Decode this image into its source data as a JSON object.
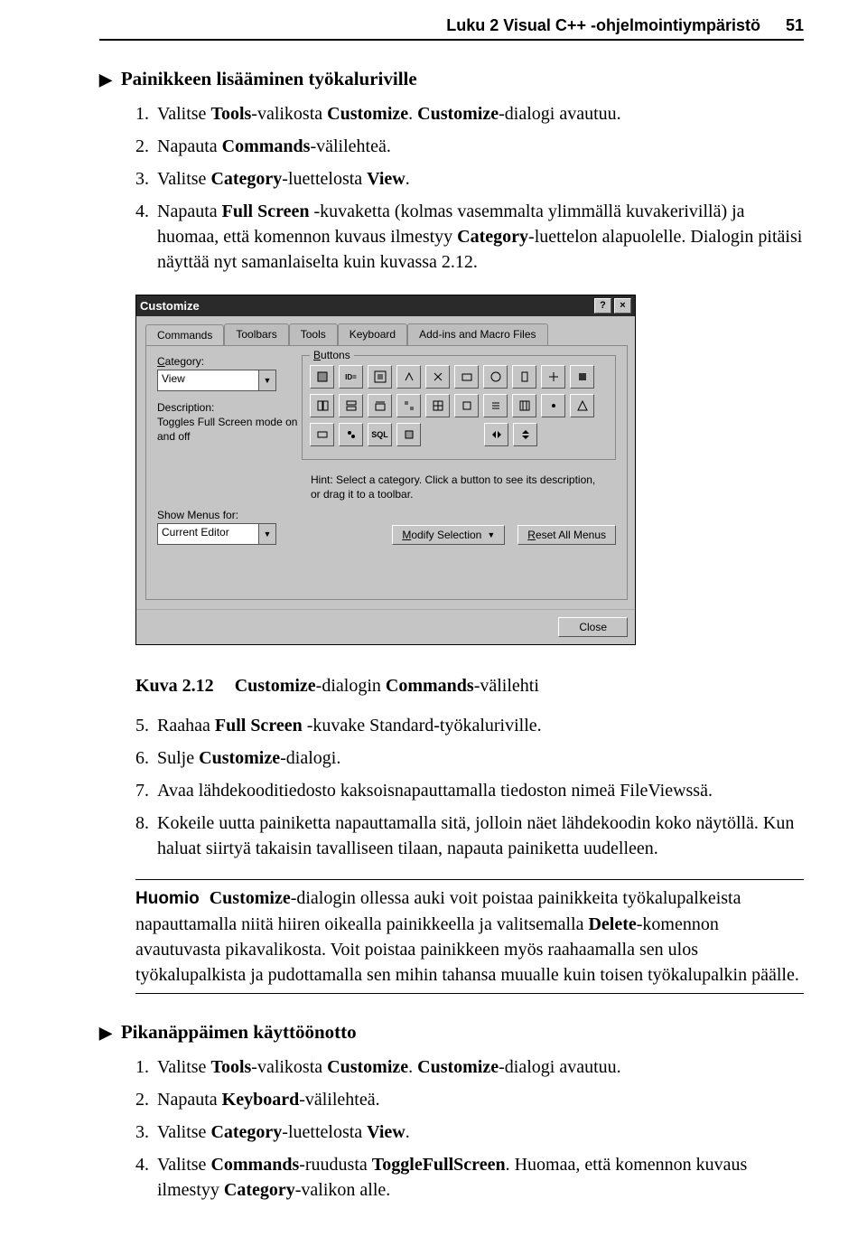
{
  "header": {
    "chapter": "Luku 2   Visual C++ -ohjelmointiympäristö",
    "page": "51"
  },
  "section1": {
    "title": "Painikkeen lisääminen työkaluriville",
    "steps": {
      "s1a": "Valitse ",
      "s1b": "Tools",
      "s1c": "-valikosta ",
      "s1d": "Customize",
      "s1e": ". ",
      "s1f": "Customize",
      "s1g": "-dialogi avautuu.",
      "s2a": "Napauta ",
      "s2b": "Commands",
      "s2c": "-välilehteä.",
      "s3a": "Valitse ",
      "s3b": "Category",
      "s3c": "-luettelosta ",
      "s3d": "View",
      "s3e": ".",
      "s4a": "Napauta ",
      "s4b": "Full Screen",
      "s4c": " -kuvaketta (kolmas vasemmalta ylimmällä kuvakerivillä) ja huomaa, että komennon kuvaus ilmestyy ",
      "s4d": "Category",
      "s4e": "-luettelon alapuolelle. Dialogin pitäisi näyttää nyt samanlaiselta kuin kuvassa 2.12."
    }
  },
  "dialog": {
    "title": "Customize",
    "help": "?",
    "close": "×",
    "tabs": [
      "Commands",
      "Toolbars",
      "Tools",
      "Keyboard",
      "Add-ins and Macro Files"
    ],
    "category_label_pre": "C",
    "category_label_post": "ategory:",
    "category_value": "View",
    "buttons_label_pre": "B",
    "buttons_label_post": "uttons",
    "id_text": "ID=",
    "desc_label": "Description:",
    "desc_text": "Toggles Full Screen mode on and off",
    "hint": "Hint: Select a category. Click a button to see its description, or drag it to a toolbar.",
    "show_label": "Show Menus for:",
    "show_value": "Current Editor",
    "modify_btn_pre": "M",
    "modify_btn_post": "odify Selection",
    "reset_btn_pre": "R",
    "reset_btn_post": "eset All Menus",
    "close_btn": "Close"
  },
  "caption": {
    "num": "Kuva 2.12",
    "text_a": "Customize",
    "text_b": "-dialogin ",
    "text_c": "Commands",
    "text_d": "-välilehti"
  },
  "section1b": {
    "s5a": "Raahaa ",
    "s5b": "Full Screen",
    "s5c": " -kuvake Standard-työkaluriville.",
    "s6a": "Sulje ",
    "s6b": "Customize",
    "s6c": "-dialogi.",
    "s7a": "Avaa lähdekooditiedosto kaksoisnapauttamalla tiedoston nimeä FileViewssä.",
    "s8a": "Kokeile uutta painiketta napauttamalla sitä, jolloin näet lähdekoodin koko näytöllä. Kun haluat siirtyä takaisin tavalliseen tilaan, napauta painiketta uudelleen."
  },
  "note": {
    "label": "Huomio",
    "t1": "Customize",
    "t2": "-dialogin ollessa auki voit poistaa painikkeita työkalupalkeista napauttamalla niitä hiiren oikealla painikkeella ja valitsemalla ",
    "t3": "Delete",
    "t4": "-komennon avautuvasta pikavalikosta. Voit poistaa painikkeen myös raahaamalla sen ulos työkalupalkista ja pudottamalla sen mihin tahansa muualle kuin toisen työkalupalkin päälle."
  },
  "section2": {
    "title": "Pikanäppäimen käyttöönotto",
    "s1a": "Valitse ",
    "s1b": "Tools",
    "s1c": "-valikosta ",
    "s1d": "Customize",
    "s1e": ". ",
    "s1f": "Customize",
    "s1g": "-dialogi avautuu.",
    "s2a": "Napauta ",
    "s2b": "Keyboard",
    "s2c": "-välilehteä.",
    "s3a": "Valitse ",
    "s3b": "Category",
    "s3c": "-luettelosta ",
    "s3d": "View",
    "s3e": ".",
    "s4a": "Valitse ",
    "s4b": "Commands",
    "s4c": "-ruudusta ",
    "s4d": "ToggleFullScreen",
    "s4e": ". Huomaa, että komennon kuvaus ilmestyy ",
    "s4f": "Category",
    "s4g": "-valikon alle."
  }
}
